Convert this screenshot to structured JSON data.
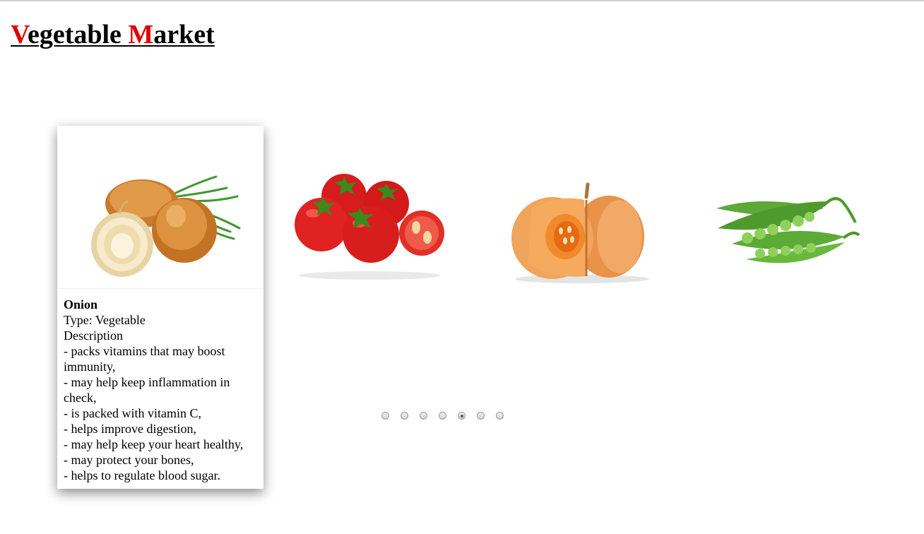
{
  "header": {
    "title_part1_cap": "V",
    "title_part1_rest": "egetable ",
    "title_part2_cap": "M",
    "title_part2_rest": "arket"
  },
  "colors": {
    "accent": "#e00000",
    "onion": "#d9893a",
    "tomato": "#d81e1e",
    "pumpkin": "#f0a25a",
    "peas": "#6cb33b"
  },
  "carousel": {
    "selected_card": {
      "name": "Onion",
      "type_line": "Type: Vegetable",
      "description_label": "Description",
      "description_lines": [
        "- packs vitamins that may boost immunity,",
        "- may help keep inflammation in check,",
        "- is packed with vitamin C,",
        "- helps improve digestion,",
        "- may help keep your heart healthy,",
        "- may protect your bones,",
        "- helps to regulate blood sugar."
      ],
      "image_icon": "onion-image"
    },
    "items": [
      {
        "icon": "tomato-image"
      },
      {
        "icon": "pumpkin-image"
      },
      {
        "icon": "peas-image"
      }
    ],
    "pagination": {
      "total": 7,
      "active_index": 4
    }
  }
}
